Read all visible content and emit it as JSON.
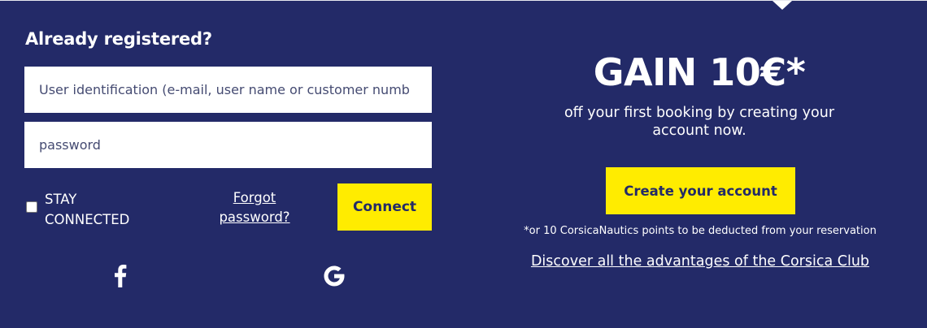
{
  "login": {
    "title": "Already registered?",
    "user_placeholder": "User identification (e-mail, user name or customer numb",
    "password_placeholder": "password",
    "stay_connected_label": "STAY CONNECTED",
    "stay_connected_checked": false,
    "forgot_label": "Forgot password?",
    "connect_label": "Connect",
    "social_icons": [
      "facebook-icon",
      "google-icon"
    ]
  },
  "promo": {
    "title": "GAIN 10€*",
    "text": "off your first booking by creating your account now.",
    "create_label": "Create your account",
    "note": "*or 10 CorsicaNautics points to be deducted from your reservation",
    "club_link": "Discover all the advantages of the Corsica Club"
  },
  "colors": {
    "background": "#232a68",
    "accent": "#ffec00",
    "text": "#ffffff"
  }
}
